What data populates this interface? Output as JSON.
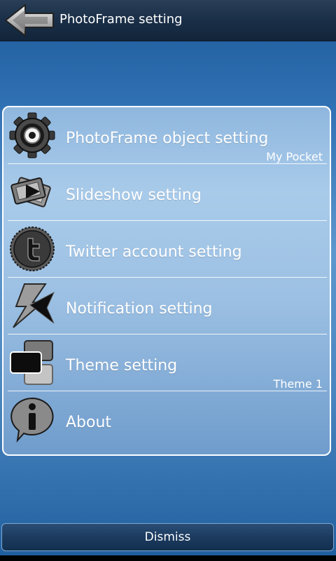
{
  "header": {
    "title": "PhotoFrame setting",
    "back_icon": "back-arrow-icon"
  },
  "menu": {
    "items": [
      {
        "label": "PhotoFrame object setting",
        "value": "My Pocket",
        "icon": "gear-icon"
      },
      {
        "label": "Slideshow setting",
        "value": "",
        "icon": "slideshow-icon"
      },
      {
        "label": "Twitter account setting",
        "value": "",
        "icon": "twitter-icon"
      },
      {
        "label": "Notification setting",
        "value": "",
        "icon": "notification-icon"
      },
      {
        "label": "Theme setting",
        "value": "Theme 1",
        "icon": "theme-icon"
      },
      {
        "label": "About",
        "value": "",
        "icon": "info-icon"
      }
    ]
  },
  "footer": {
    "dismiss_label": "Dismiss"
  },
  "colors": {
    "header_bg": "#1b3049",
    "accent_blue": "#4a86c0",
    "text": "#ffffff"
  }
}
